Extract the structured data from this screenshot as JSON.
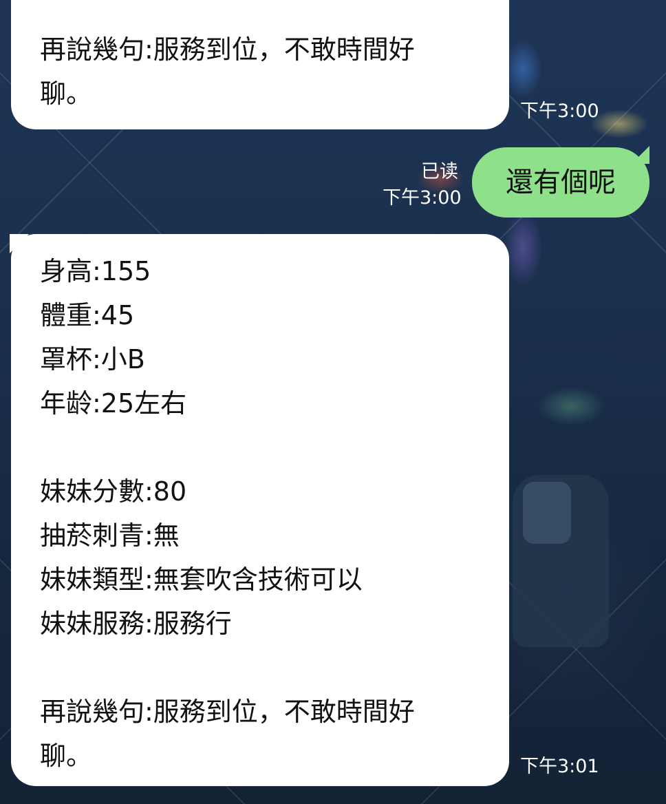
{
  "messages": {
    "top": {
      "lines": [
        "再說幾句:服務到位，不敢時間好",
        "聊。"
      ],
      "time": "下午3:00"
    },
    "green": {
      "text": "還有個呢",
      "status": "已读",
      "time": "下午3:00"
    },
    "main": {
      "lines": [
        "身高:155",
        "體重:45",
        "罩杯:小B",
        "年龄:25左右",
        "",
        "妹妹分數:80",
        "抽菸刺青:無",
        "妹妹類型:無套吹含技術可以",
        "妹妹服務:服務行",
        "",
        "再說幾句:服務到位，不敢時間好",
        "聊。"
      ],
      "time": "下午3:01"
    }
  },
  "colors": {
    "incoming_bubble": "#ffffff",
    "outgoing_bubble": "#8ee08a",
    "background": "#1b2f4a",
    "timestamp": "#ffffff"
  }
}
